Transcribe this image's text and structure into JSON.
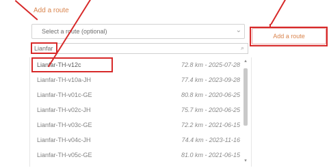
{
  "window": {
    "title": "Add a route"
  },
  "route_select": {
    "placeholder": "Select a route (optional)",
    "filter_value": "Lianfar"
  },
  "actions": {
    "add_route": "Add a route"
  },
  "routes": [
    {
      "name": "Lianfar-TH-v12c",
      "meta": "72.8 km - 2025-07-28"
    },
    {
      "name": "Lianfar-TH-v10a-JH",
      "meta": "77.4 km - 2023-09-28"
    },
    {
      "name": "Lianfar-TH-v01c-GE",
      "meta": "80.8 km - 2020-06-25"
    },
    {
      "name": "Lianfar-TH-v02c-JH",
      "meta": "75.7 km - 2020-06-25"
    },
    {
      "name": "Lianfar-TH-v03c-GE",
      "meta": "72.2 km - 2021-06-15"
    },
    {
      "name": "Lianfar-TH-v04c-JH",
      "meta": "74.4 km - 2023-11-16"
    },
    {
      "name": "Lianfar-TH-v05c-GE",
      "meta": "81.0 km - 2021-06-15"
    }
  ],
  "colors": {
    "annotation_red": "#d72828",
    "accent_orange": "#d9844d"
  }
}
